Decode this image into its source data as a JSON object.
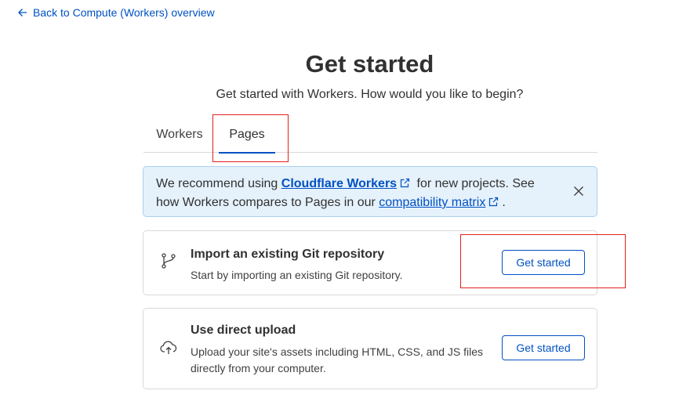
{
  "back_link": {
    "label": "Back to Compute (Workers) overview"
  },
  "header": {
    "title": "Get started",
    "subtitle": "Get started with Workers. How would you like to begin?"
  },
  "tabs": [
    {
      "label": "Workers",
      "active": false
    },
    {
      "label": "Pages",
      "active": true
    }
  ],
  "banner": {
    "text_1": "We recommend using ",
    "link_1": "Cloudflare Workers",
    "text_2": " for new projects. See how Workers compares to Pages in our ",
    "link_2": "compatibility matrix",
    "text_3": "."
  },
  "cards": [
    {
      "title": "Import an existing Git repository",
      "description": "Start by importing an existing Git repository.",
      "button": "Get started",
      "icon": "git-branch-icon"
    },
    {
      "title": "Use direct upload",
      "description": "Upload your site's assets including HTML, CSS, and JS files directly from your computer.",
      "button": "Get started",
      "icon": "cloud-upload-icon"
    }
  ],
  "colors": {
    "accent": "#0051c3",
    "banner_bg": "#e5f1fb",
    "highlight": "#e0211b"
  }
}
